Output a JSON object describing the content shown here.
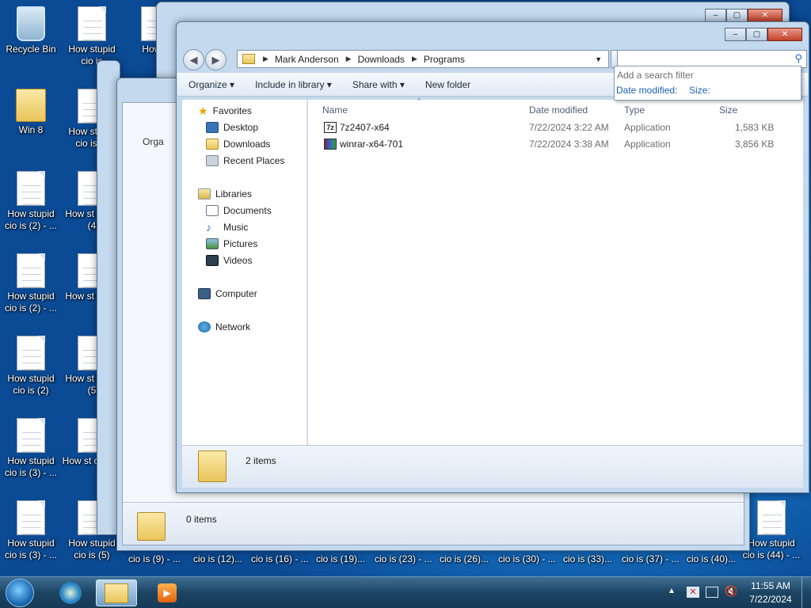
{
  "desktop": {
    "icons": [
      {
        "label": "Recycle Bin",
        "kind": "bin"
      },
      {
        "label": "Win 8",
        "kind": "folder"
      },
      {
        "label": "How stupid cio is (2) - ...",
        "kind": "doc"
      },
      {
        "label": "How stupid cio is (2) - ...",
        "kind": "doc"
      },
      {
        "label": "How stupid cio is (2)",
        "kind": "doc"
      },
      {
        "label": "How stupid cio is (3) - ...",
        "kind": "doc"
      },
      {
        "label": "How stupid cio is (3) - ...",
        "kind": "doc"
      },
      {
        "label": "How stupid cio is",
        "kind": "doc"
      },
      {
        "label": "How stupid cio is (4",
        "kind": "doc"
      },
      {
        "label": "How st cio is (4",
        "kind": "doc"
      },
      {
        "label": "How st cio is",
        "kind": "doc"
      },
      {
        "label": "How st cio is (5",
        "kind": "doc"
      },
      {
        "label": "How st cio is (",
        "kind": "doc"
      },
      {
        "label": "How stupid cio is (5)",
        "kind": "doc"
      },
      {
        "label": "How s",
        "kind": "doc"
      },
      {
        "label": "How stupid cio is (44) - ...",
        "kind": "doc"
      }
    ],
    "bottom_labels": [
      "cio is (9) - ...",
      "cio is (12)...",
      "cio is (16) - ...",
      "cio is (19)...",
      "cio is (23) - ...",
      "cio is (26)...",
      "cio is (30) - ...",
      "cio is (33)...",
      "cio is (37) - ...",
      "cio is (40)..."
    ]
  },
  "back_window": {
    "items_count": "0 items",
    "nav_partial": "Orga"
  },
  "explorer": {
    "breadcrumb": [
      "Mark Anderson",
      "Downloads",
      "Programs"
    ],
    "search_placeholder": "",
    "toolbar": {
      "organize": "Organize",
      "include_in_library": "Include in library",
      "share_with": "Share with",
      "new_folder": "New folder"
    },
    "nav": {
      "favorites": "Favorites",
      "desktop": "Desktop",
      "downloads": "Downloads",
      "recent_places": "Recent Places",
      "libraries": "Libraries",
      "documents": "Documents",
      "music": "Music",
      "pictures": "Pictures",
      "videos": "Videos",
      "computer": "Computer",
      "network": "Network"
    },
    "columns": {
      "name": "Name",
      "date_modified": "Date modified",
      "type": "Type",
      "size": "Size"
    },
    "files": [
      {
        "name": "7z2407-x64",
        "date": "7/22/2024 3:22 AM",
        "type": "Application",
        "size": "1,583 KB",
        "icon": "7zip-icon"
      },
      {
        "name": "winrar-x64-701",
        "date": "7/22/2024 3:38 AM",
        "type": "Application",
        "size": "3,856 KB",
        "icon": "winrar-icon"
      }
    ],
    "status": "2 items",
    "search_popup": {
      "title": "Add a search filter",
      "filter1": "Date modified:",
      "filter2": "Size:"
    }
  },
  "taskbar": {
    "time": "11:55 AM",
    "date": "7/22/2024"
  },
  "colors": {
    "accent_link": "#1a5fb4",
    "selection": "#cce8ff"
  }
}
